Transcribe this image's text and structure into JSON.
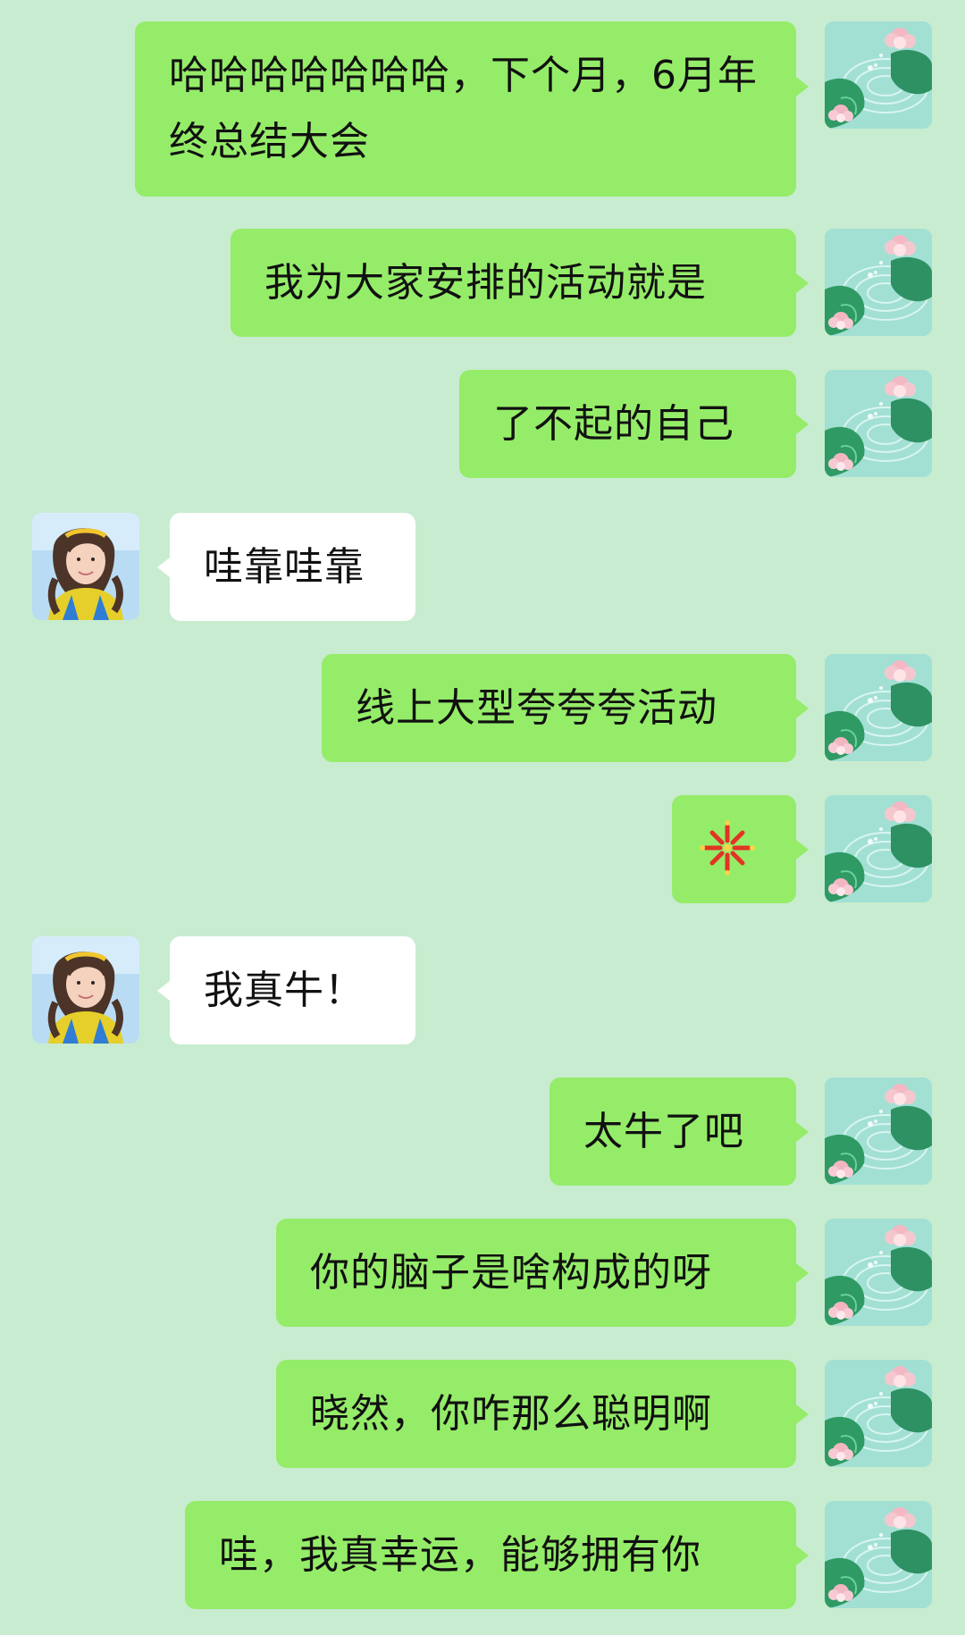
{
  "messages": [
    {
      "side": "me",
      "text": "哈哈哈哈哈哈哈，下个月，6月年终总结大会"
    },
    {
      "side": "me",
      "text": "我为大家安排的活动就是"
    },
    {
      "side": "me",
      "text": "了不起的自己"
    },
    {
      "side": "them",
      "text": "哇靠哇靠"
    },
    {
      "side": "me",
      "text": "线上大型夸夸夸活动"
    },
    {
      "side": "me",
      "emoji": "fireworks-icon"
    },
    {
      "side": "them",
      "text": "我真牛！"
    },
    {
      "side": "me",
      "text": "太牛了吧"
    },
    {
      "side": "me",
      "text": "你的脑子是啥构成的呀"
    },
    {
      "side": "me",
      "text": "晓然，你咋那么聪明啊"
    },
    {
      "side": "me",
      "text": "哇，我真幸运，能够拥有你"
    }
  ],
  "colors": {
    "background": "#c8ecd0",
    "my_bubble": "#95ec69",
    "their_bubble": "#ffffff"
  }
}
